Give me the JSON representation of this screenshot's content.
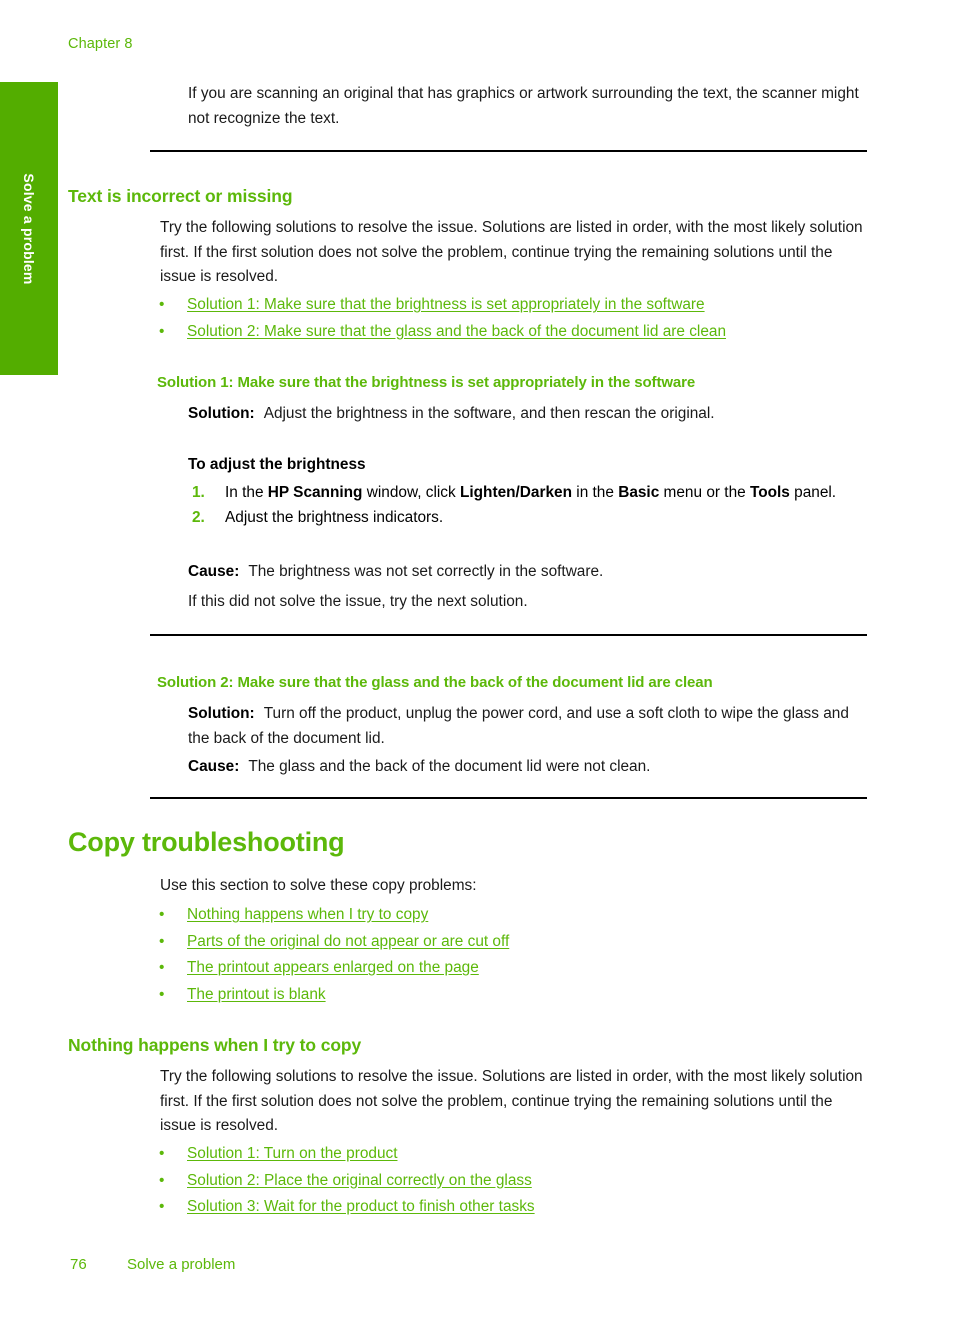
{
  "page": {
    "chapter_header": "Chapter 8",
    "side_tab_label": "Solve a problem",
    "tab_color": "#53AD00",
    "heading_color": "#5CB80A",
    "link_color": "#5CB80A",
    "body_color": "#1a1a1a"
  },
  "intro": {
    "paragraph": "If you are scanning an original that has graphics or artwork surrounding the text, the scanner might not recognize the text."
  },
  "section_text_incorrect": {
    "heading": "Text is incorrect or missing",
    "intro": "Try the following solutions to resolve the issue. Solutions are listed in order, with the most likely solution first. If the first solution does not solve the problem, continue trying the remaining solutions until the issue is resolved.",
    "links": [
      {
        "bullet": "•",
        "label": "Solution 1: Make sure that the brightness is set appropriately in the software"
      },
      {
        "bullet": "•",
        "label": "Solution 2: Make sure that the glass and the back of the document lid are clean"
      }
    ],
    "solution1": {
      "heading": "Solution 1: Make sure that the brightness is set appropriately in the software",
      "solution_label": "Solution:",
      "solution_text": "Adjust the brightness in the software, and then rescan the original.",
      "procedure_title": "To adjust the brightness",
      "steps": [
        {
          "num": "1.",
          "pre": "In the ",
          "b1": "HP Scanning",
          "mid1": " window, click ",
          "b2": "Lighten/Darken",
          "mid2": " in the ",
          "b3": "Basic",
          "mid3": " menu or the ",
          "b4": "Tools",
          "post": " panel."
        },
        {
          "num": "2.",
          "pre": "Adjust the brightness indicators.",
          "b1": "",
          "mid1": "",
          "b2": "",
          "mid2": "",
          "b3": "",
          "mid3": "",
          "b4": "",
          "post": ""
        }
      ],
      "cause_label": "Cause:",
      "cause_text": "The brightness was not set correctly in the software.",
      "next": "If this did not solve the issue, try the next solution."
    },
    "solution2": {
      "heading": "Solution 2: Make sure that the glass and the back of the document lid are clean",
      "solution_label": "Solution:",
      "solution_text": "Turn off the product, unplug the power cord, and use a soft cloth to wipe the glass and the back of the document lid.",
      "cause_label": "Cause:",
      "cause_text": "The glass and the back of the document lid were not clean."
    }
  },
  "section_copy": {
    "heading": "Copy troubleshooting",
    "intro": "Use this section to solve these copy problems:",
    "links": [
      {
        "bullet": "•",
        "label": "Nothing happens when I try to copy"
      },
      {
        "bullet": "•",
        "label": "Parts of the original do not appear or are cut off"
      },
      {
        "bullet": "•",
        "label": "The printout appears enlarged on the page"
      },
      {
        "bullet": "•",
        "label": "The printout is blank"
      }
    ],
    "subsection": {
      "heading": "Nothing happens when I try to copy",
      "intro": "Try the following solutions to resolve the issue. Solutions are listed in order, with the most likely solution first. If the first solution does not solve the problem, continue trying the remaining solutions until the issue is resolved.",
      "links": [
        {
          "bullet": "•",
          "label": "Solution 1: Turn on the product"
        },
        {
          "bullet": "•",
          "label": "Solution 2: Place the original correctly on the glass"
        },
        {
          "bullet": "•",
          "label": "Solution 3: Wait for the product to finish other tasks"
        }
      ]
    }
  },
  "footer": {
    "page_number": "76",
    "title": "Solve a problem"
  }
}
